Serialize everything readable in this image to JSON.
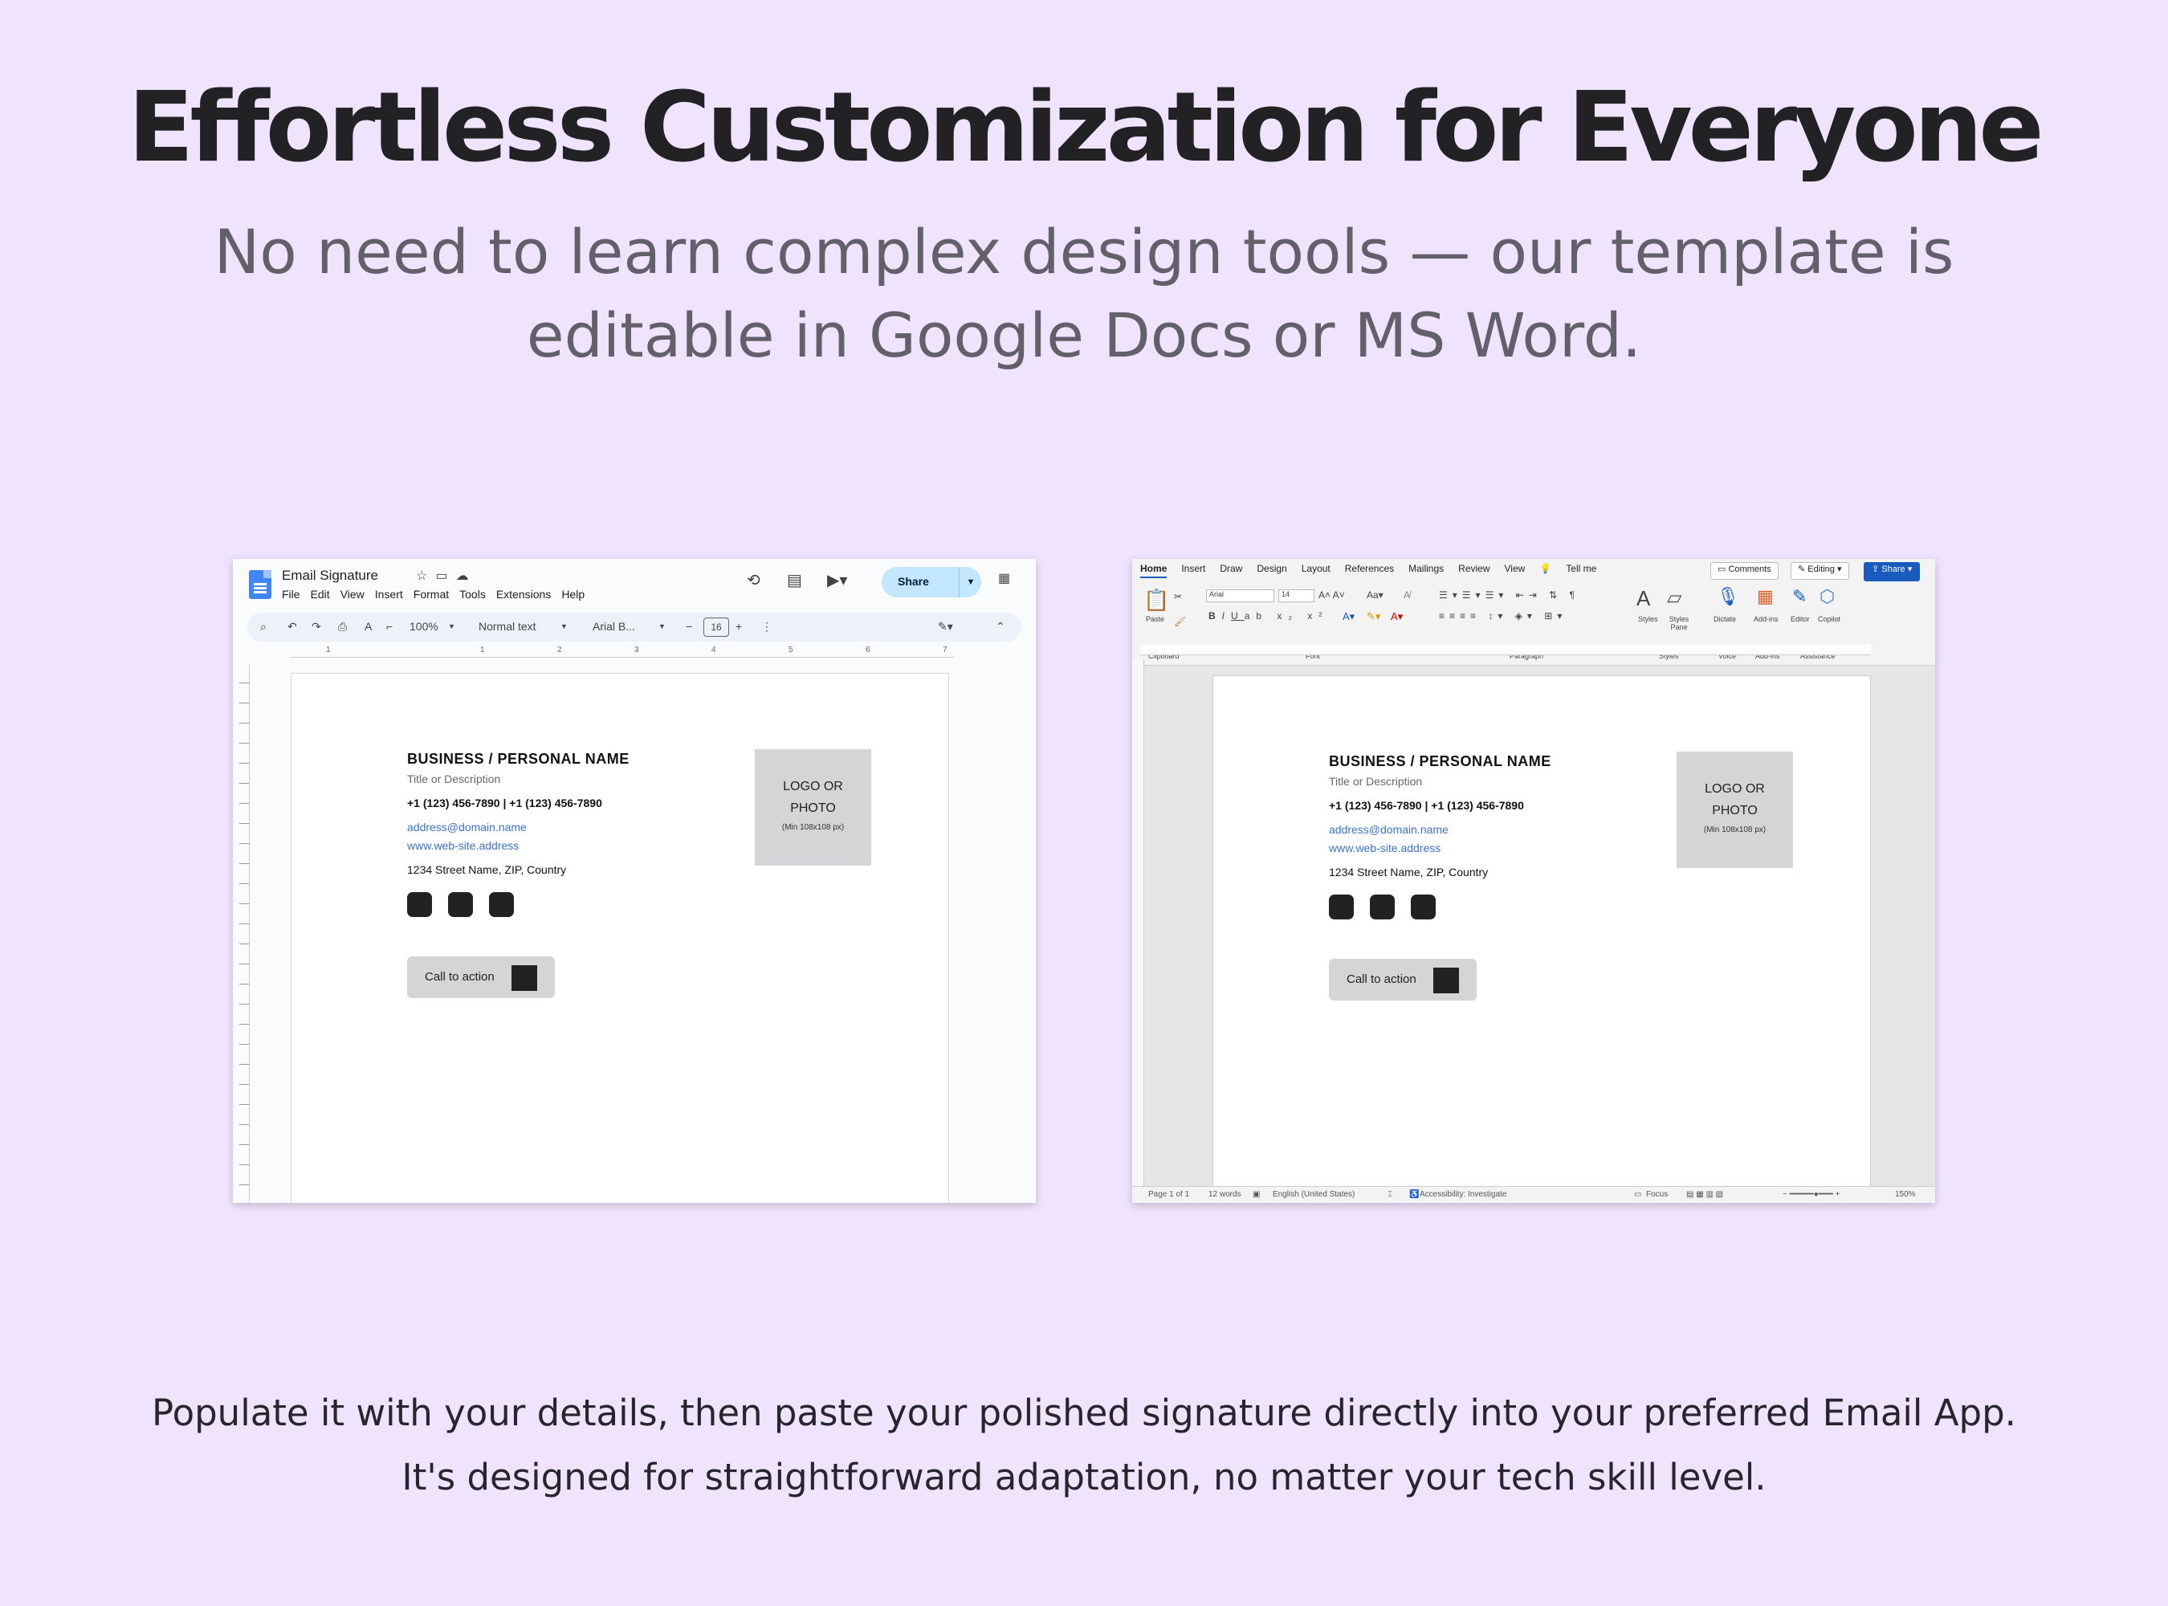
{
  "headline": "Effortless Customization for Everyone",
  "subheadline": "No need to learn complex design tools — our template is editable in Google Docs or MS Word.",
  "footer": {
    "line1": "Populate it with your details, then paste your polished signature directly into your preferred Email App.",
    "line2": "It's designed for straightforward adaptation, no matter your tech skill level."
  },
  "gdocs": {
    "doc_title": "Email Signature",
    "menu": [
      "File",
      "Edit",
      "View",
      "Insert",
      "Format",
      "Tools",
      "Extensions",
      "Help"
    ],
    "share_label": "Share",
    "zoom": "100%",
    "style": "Normal text",
    "font": "Arial B...",
    "font_size": "16",
    "ruler_ticks": [
      "1",
      "1",
      "2",
      "3",
      "4",
      "5",
      "6",
      "7"
    ]
  },
  "word": {
    "tabs": [
      "Home",
      "Insert",
      "Draw",
      "Design",
      "Layout",
      "References",
      "Mailings",
      "Review",
      "View",
      "Tell me"
    ],
    "comments_label": "Comments",
    "editing_label": "Editing",
    "share_label": "Share",
    "font": "Arial",
    "font_size": "14",
    "ribbon_groups": [
      "Clipboard",
      "Font",
      "Paragraph",
      "Styles",
      "Voice",
      "Add-ins",
      "Assistance"
    ],
    "ribbon_buttons": [
      "Paste",
      "Styles",
      "Styles Pane",
      "Dictate",
      "Add-ins",
      "Editor",
      "Copilot"
    ],
    "status": {
      "page": "Page 1 of 1",
      "words": "12 words",
      "language": "English (United States)",
      "accessibility": "Accessibility: Investigate",
      "focus": "Focus",
      "zoom": "150%"
    }
  },
  "signature": {
    "name": "BUSINESS / PERSONAL NAME",
    "title": "Title or Description",
    "phone": "+1 (123) 456-7890 | +1 (123) 456-7890",
    "email": "address@domain.name",
    "website": "www.web-site.address",
    "address": "1234 Street Name, ZIP, Country",
    "cta_label": "Call to action",
    "logo_line1": "LOGO OR",
    "logo_line2": "PHOTO",
    "logo_note": "(Min 108x108 px)"
  }
}
